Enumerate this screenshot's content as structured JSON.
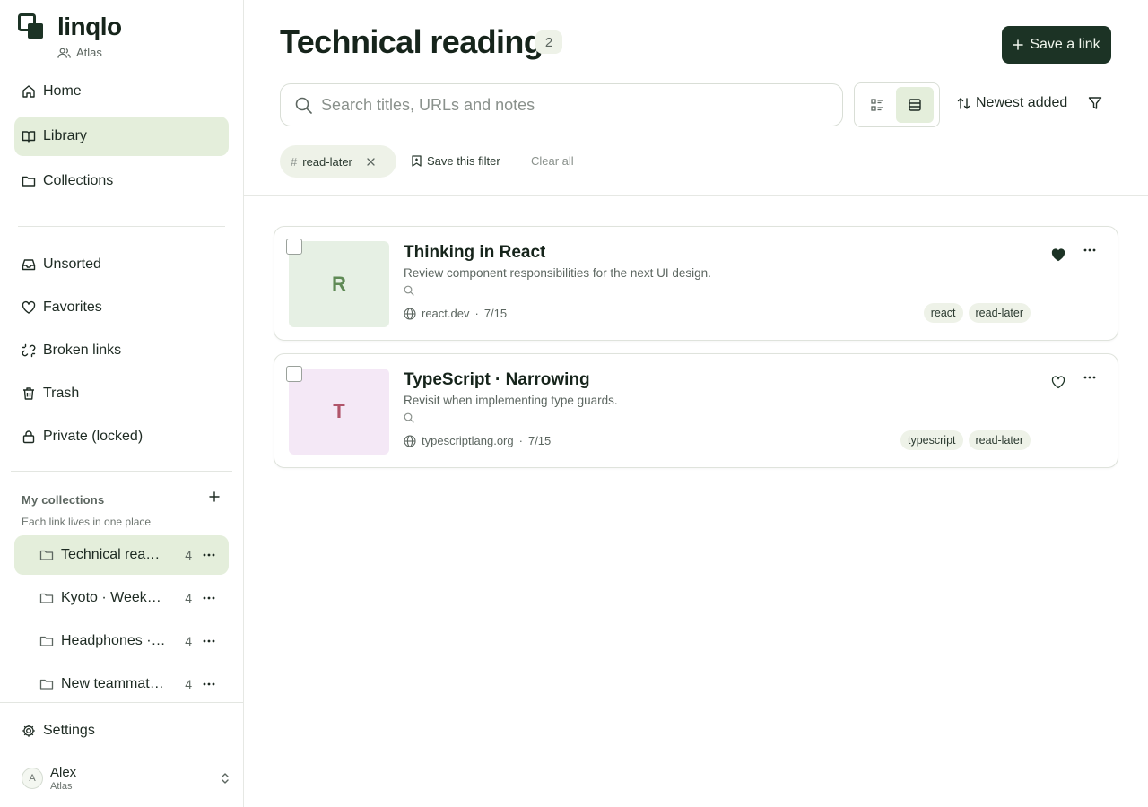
{
  "app": {
    "name": "linqlo",
    "workspace": "Atlas"
  },
  "sidebar": {
    "nav": [
      {
        "label": "Home",
        "icon": "home-icon"
      },
      {
        "label": "Library",
        "icon": "book-icon",
        "active": true
      },
      {
        "label": "Collections",
        "icon": "folder-icon"
      }
    ],
    "system": [
      {
        "label": "Unsorted",
        "icon": "inbox-icon"
      },
      {
        "label": "Favorites",
        "icon": "heart-icon"
      },
      {
        "label": "Broken links",
        "icon": "broken-link-icon"
      },
      {
        "label": "Trash",
        "icon": "trash-icon"
      },
      {
        "label": "Private (locked)",
        "icon": "lock-icon"
      }
    ],
    "my_collections": {
      "title": "My collections",
      "subtitle": "Each link lives in one place",
      "items": [
        {
          "name": "Technical reading",
          "count": "4",
          "active": true
        },
        {
          "name": "Kyoto · Weekend trip",
          "count": "4"
        },
        {
          "name": "Headphones · Research",
          "count": "4"
        },
        {
          "name": "New teammate onboarding",
          "count": "4"
        }
      ]
    },
    "settings_label": "Settings",
    "user": {
      "name": "Alex",
      "workspace": "Atlas",
      "initial": "A"
    }
  },
  "main": {
    "title": "Technical reading",
    "count": "2",
    "save_button": "Save a link",
    "search_placeholder": "Search titles, URLs and notes",
    "sort_label": "Newest added",
    "active_filter": {
      "hash": "#",
      "tag": "read-later"
    },
    "save_filter_label": "Save this filter",
    "clear_all_label": "Clear all",
    "links": [
      {
        "letter": "R",
        "title": "Thinking in React",
        "note": "Review component responsibilities for the next UI design.",
        "domain": "react.dev",
        "date": "7/15",
        "tags": [
          "react",
          "read-later"
        ],
        "favorite": true,
        "thumb_bg": "#e6f0e4",
        "thumb_fg": "#5f8a55"
      },
      {
        "letter": "T",
        "title": "TypeScript · Narrowing",
        "note": "Revisit when implementing type guards.",
        "domain": "typescriptlang.org",
        "date": "7/15",
        "tags": [
          "typescript",
          "read-later"
        ],
        "favorite": false,
        "thumb_bg": "#f4e8f6",
        "thumb_fg": "#b0546a"
      }
    ]
  },
  "colors": {
    "accent": "#1c3325",
    "active_bg": "#e4eedb",
    "chip_bg": "#eef2e8"
  }
}
